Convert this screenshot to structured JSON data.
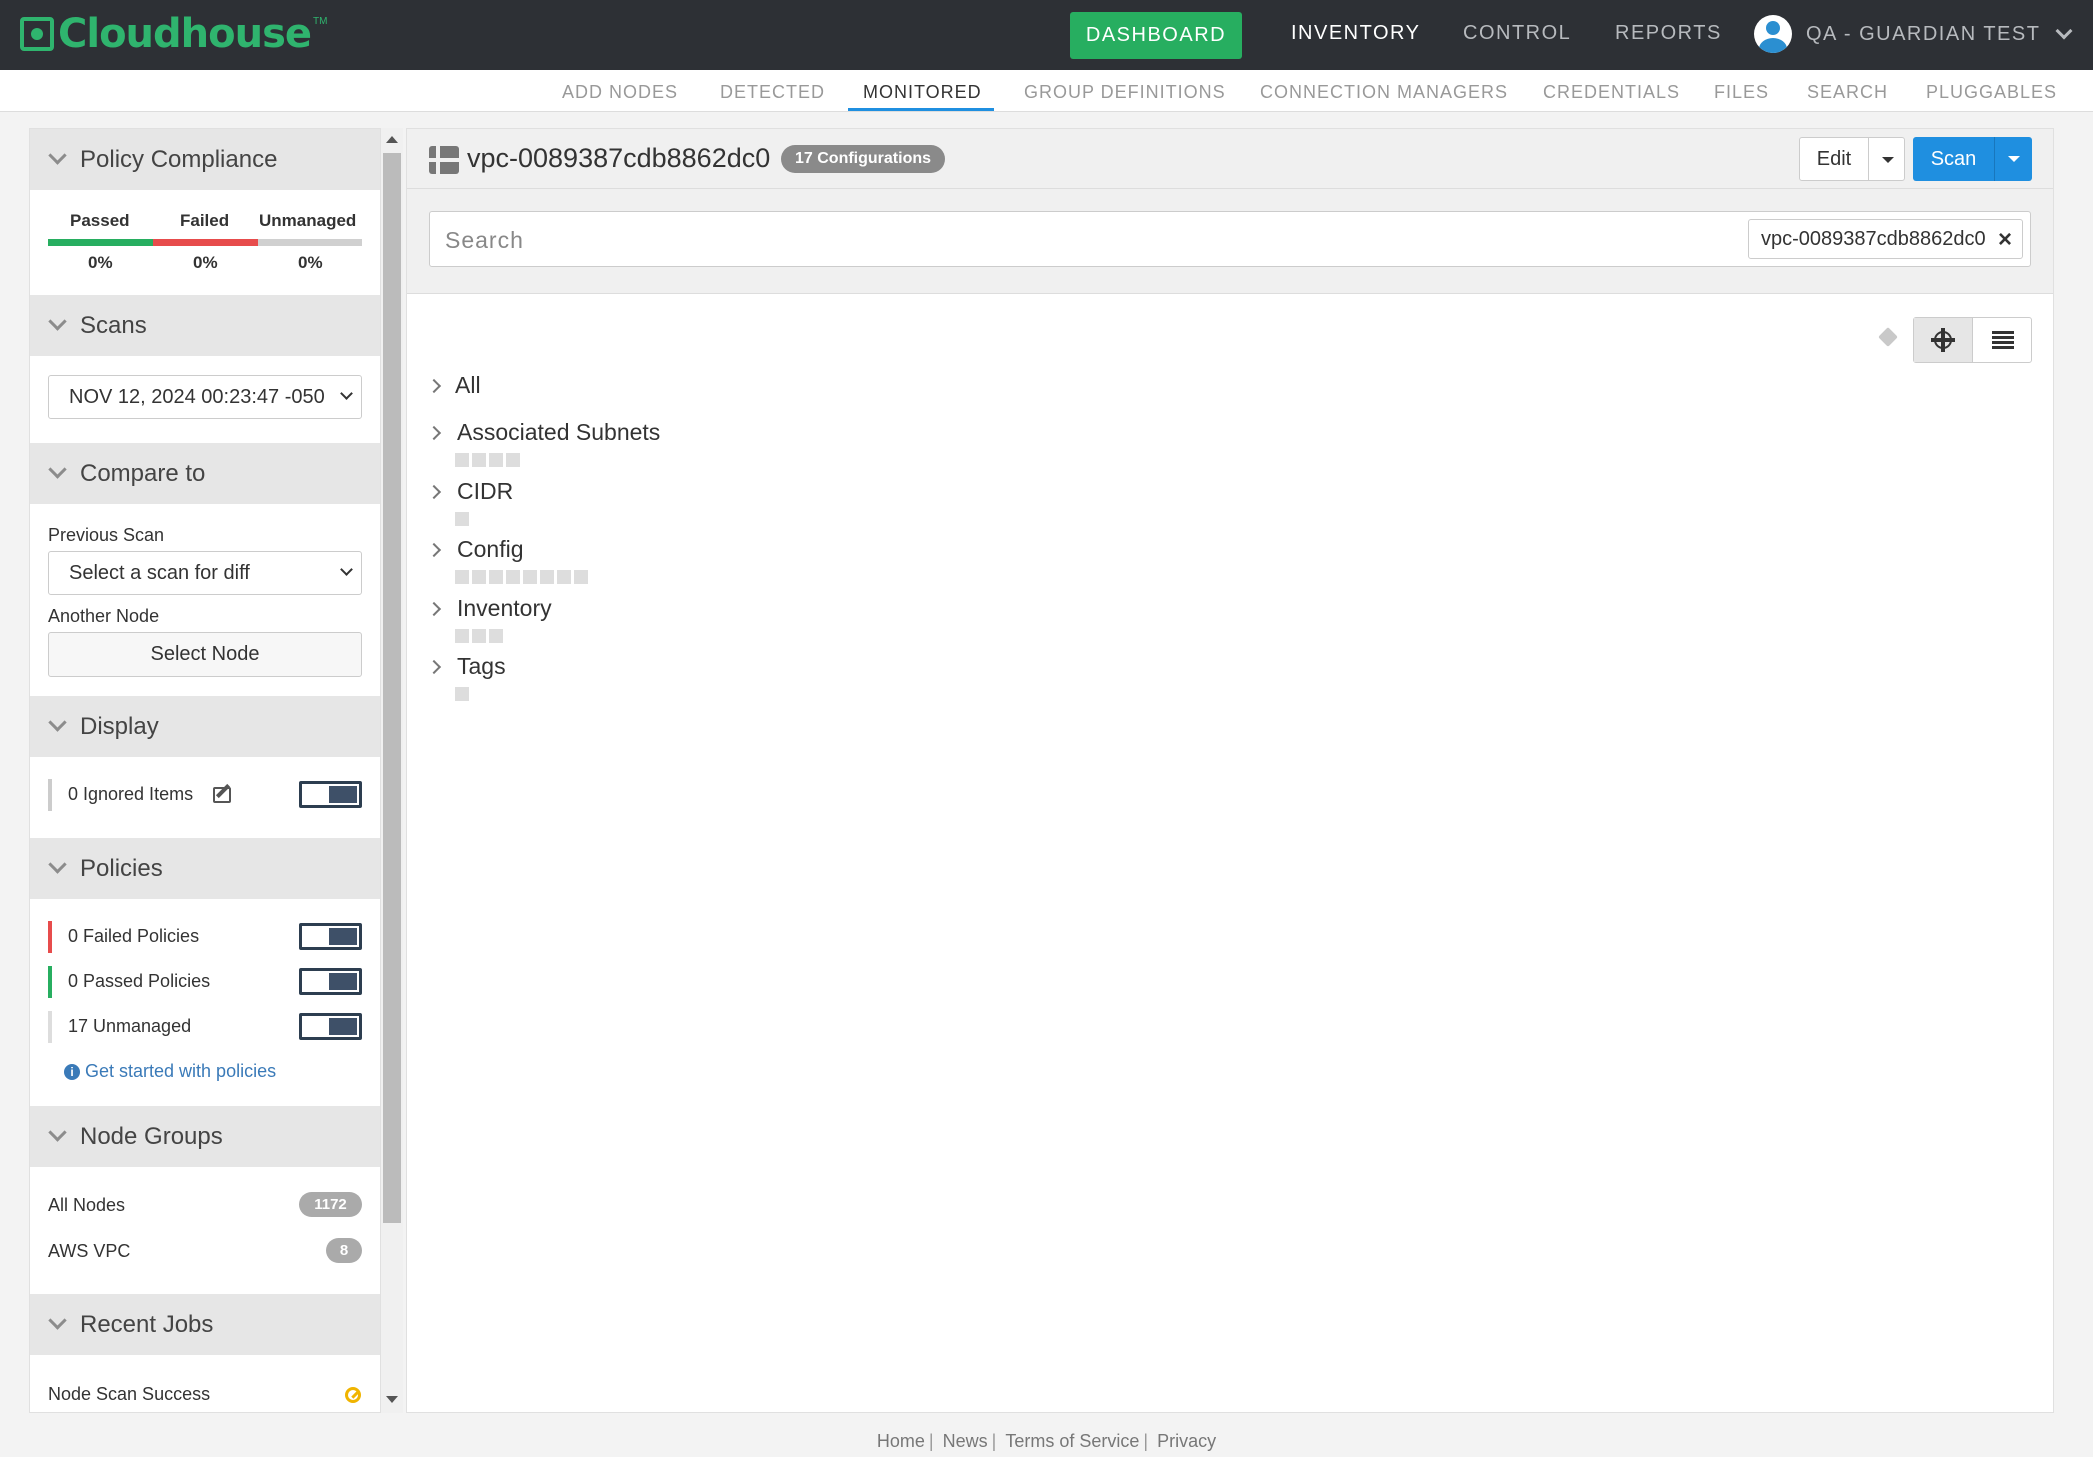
{
  "brand": {
    "name": "Cloudhouse",
    "tm": "TM"
  },
  "topnav": {
    "dashboard": "DASHBOARD",
    "inventory": "INVENTORY",
    "control": "CONTROL",
    "reports": "REPORTS",
    "user": "QA - GUARDIAN TEST"
  },
  "subnav": [
    "ADD NODES",
    "DETECTED",
    "MONITORED",
    "GROUP DEFINITIONS",
    "CONNECTION MANAGERS",
    "CREDENTIALS",
    "FILES",
    "SEARCH",
    "PLUGGABLES"
  ],
  "sidebar": {
    "policy_compliance": {
      "title": "Policy Compliance",
      "passed_label": "Passed",
      "failed_label": "Failed",
      "unmanaged_label": "Unmanaged",
      "passed_pct": "0%",
      "failed_pct": "0%",
      "unmanaged_pct": "0%",
      "colors": {
        "passed": "#27ae60",
        "failed": "#e74c4c",
        "unmanaged": "#d0d0d0"
      }
    },
    "scans": {
      "title": "Scans",
      "selected": "NOV 12, 2024 00:23:47 -050"
    },
    "compare": {
      "title": "Compare to",
      "previous_label": "Previous Scan",
      "previous_placeholder": "Select a scan for diff",
      "another_label": "Another Node",
      "select_node": "Select Node"
    },
    "display": {
      "title": "Display",
      "ignored": "0 Ignored Items"
    },
    "policies": {
      "title": "Policies",
      "failed": "0 Failed Policies",
      "passed": "0 Passed Policies",
      "unmanaged": "17 Unmanaged",
      "get_started": "Get started with policies"
    },
    "node_groups": {
      "title": "Node Groups",
      "items": [
        {
          "label": "All Nodes",
          "count": "1172"
        },
        {
          "label": "AWS VPC",
          "count": "8"
        }
      ]
    },
    "recent_jobs": {
      "title": "Recent Jobs",
      "first": "Node Scan Success"
    }
  },
  "main": {
    "title": "vpc-0089387cdb8862dc0",
    "config_badge": "17 Configurations",
    "edit": "Edit",
    "scan": "Scan",
    "search_placeholder": "Search",
    "search_chip": "vpc-0089387cdb8862dc0",
    "tree": [
      {
        "label": "All",
        "dots": 0
      },
      {
        "label": "Associated Subnets",
        "dots": 4
      },
      {
        "label": "CIDR",
        "dots": 1
      },
      {
        "label": "Config",
        "dots": 8
      },
      {
        "label": "Inventory",
        "dots": 3
      },
      {
        "label": "Tags",
        "dots": 1
      }
    ]
  },
  "footer": {
    "home": "Home",
    "news": "News",
    "terms": "Terms of Service",
    "privacy": "Privacy"
  }
}
